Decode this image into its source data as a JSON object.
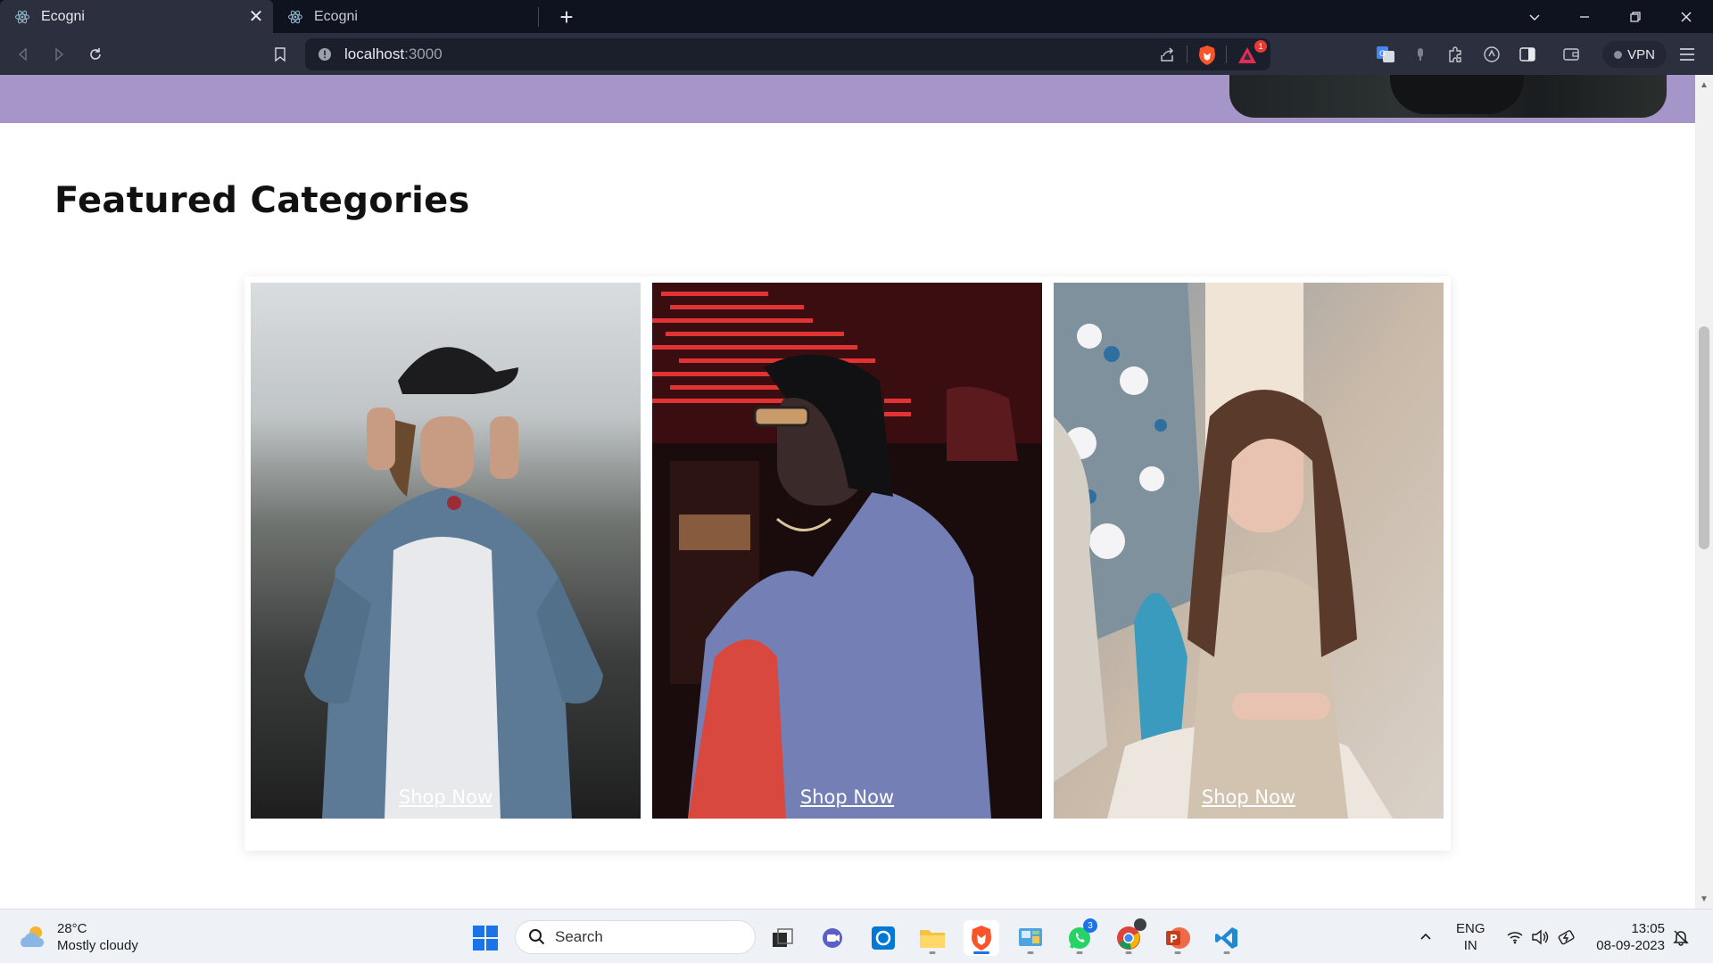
{
  "browser": {
    "tabs": [
      {
        "title": "Ecogni",
        "active": true
      },
      {
        "title": "Ecogni",
        "active": false
      }
    ],
    "url": {
      "host": "localhost",
      "port": ":3000"
    },
    "brave_alert_count": "1",
    "vpn_label": "VPN"
  },
  "page": {
    "section_title": "Featured Categories",
    "categories": [
      {
        "link_text": "Shop Now",
        "image": "man-denim-jacket-photo"
      },
      {
        "link_text": "Shop Now",
        "image": "woman-neon-sunglasses-photo"
      },
      {
        "link_text": "Shop Now",
        "image": "girl-christmas-tree-photo"
      }
    ]
  },
  "taskbar": {
    "weather": {
      "temp": "28°C",
      "condition": "Mostly cloudy"
    },
    "search_label": "Search",
    "whatsapp_badge": "3",
    "language": {
      "line1": "ENG",
      "line2": "IN"
    },
    "clock": {
      "time": "13:05",
      "date": "08-09-2023"
    }
  },
  "colors": {
    "hero_band": "#a595c9",
    "tab_strip": "#0f1320",
    "toolbar": "#2c2f3e",
    "taskbar_accent": "#1a73e8"
  }
}
